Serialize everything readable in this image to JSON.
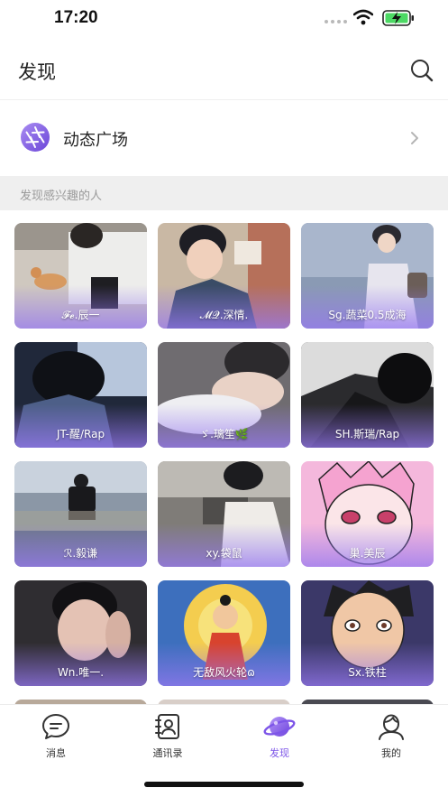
{
  "status_bar": {
    "time": "17:20"
  },
  "header": {
    "title": "发现"
  },
  "moments": {
    "label": "动态广场"
  },
  "section": {
    "title": "发现感兴趣的人"
  },
  "people": [
    {
      "name": "𝓕𝓮.辰一"
    },
    {
      "name": "𝓜𝓠.深情."
    },
    {
      "name": "Sg.蔬菜0.5成海"
    },
    {
      "name": "JT-醒/Rap"
    },
    {
      "name": "ゞ.璃笙🌿"
    },
    {
      "name": "SH.斯瑞/Rap"
    },
    {
      "name": "ℛ.毅谦"
    },
    {
      "name": "xy.袋鼠"
    },
    {
      "name": "巢.美辰"
    },
    {
      "name": "Wn.唯一."
    },
    {
      "name": "无敌风火轮ɷ"
    },
    {
      "name": "Sx.铁柱"
    }
  ],
  "tabbar": {
    "tabs": [
      {
        "label": "消息"
      },
      {
        "label": "通讯录"
      },
      {
        "label": "发现"
      },
      {
        "label": "我的"
      }
    ]
  },
  "colors": {
    "accent": "#7d55e8",
    "section_bg": "#efefef"
  }
}
